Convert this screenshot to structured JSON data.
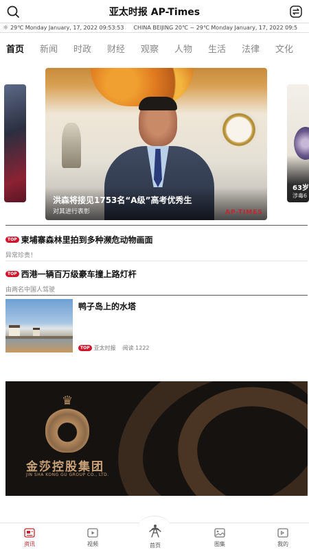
{
  "header": {
    "title": "亚太时报 AP-Times",
    "search_icon": "search-icon",
    "switch_icon": "switch-icon"
  },
  "ticker": {
    "segments": [
      "29℃ Monday January, 17, 2022  09:53:53",
      "CHINA  BEIJING  20℃ ~ 29℃ Monday January, 17, 2022  09:5"
    ]
  },
  "tabs": [
    "首页",
    "新闻",
    "时政",
    "财经",
    "观察",
    "人物",
    "生活",
    "法律",
    "文化"
  ],
  "active_tab": "首页",
  "carousel": {
    "main": {
      "title": "洪森将接见1753名“A级”高考优秀生",
      "subtitle": "对其进行表彰",
      "watermark": "AP-TIMES"
    },
    "right_peek": {
      "title": "63岁",
      "subtitle": "涉毒6"
    }
  },
  "news": [
    {
      "badge": "TOP",
      "title": "柬埔寨森林里拍到多种濒危动物画面",
      "subtitle": "异常珍贵！"
    },
    {
      "badge": "TOP",
      "title": "西港一辆百万级豪车撞上路灯杆",
      "subtitle": "由两名中国人驾驶"
    }
  ],
  "image_news": {
    "title": "鸭子岛上的水塔",
    "badge": "TOP",
    "source": "亚太时报",
    "reads": "阅读 1222"
  },
  "ad": {
    "brand": "金莎控股集团",
    "brand_en": "JIN SHA KONG GU GROUP CO., LTD."
  },
  "bottom_nav": [
    {
      "label": "资讯",
      "icon": "news-icon",
      "active": true
    },
    {
      "label": "视频",
      "icon": "video-icon",
      "active": false
    },
    {
      "label": "首页",
      "icon": "home-radio-icon",
      "active": false
    },
    {
      "label": "图集",
      "icon": "gallery-icon",
      "active": false
    },
    {
      "label": "我的",
      "icon": "profile-icon",
      "active": false
    }
  ],
  "colors": {
    "accent": "#d0162d",
    "gold": "#b58a5e"
  }
}
